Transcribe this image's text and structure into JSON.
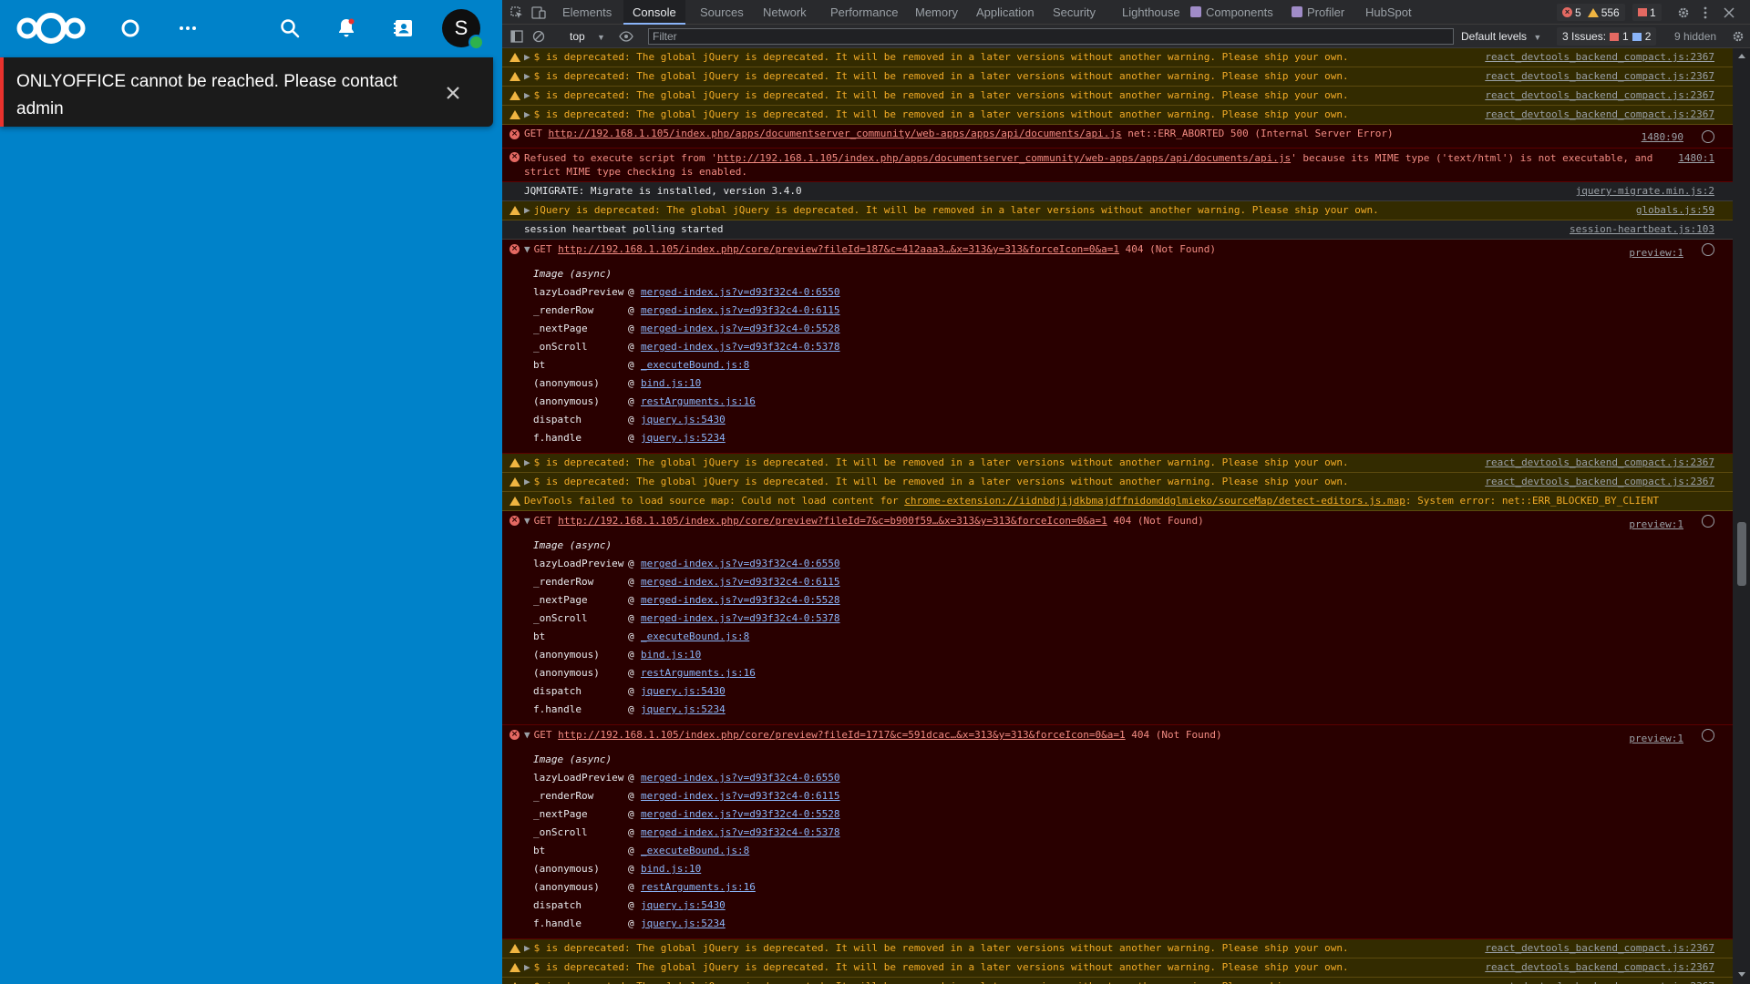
{
  "nextcloud": {
    "header_icons": [
      "nextcloud-logo",
      "dashboard-icon",
      "more-apps-icon",
      "search-icon",
      "notifications-icon",
      "contacts-icon"
    ],
    "avatar_initial": "S",
    "colors": {
      "background": "#0082c9",
      "toast_bg": "#1b1b1b",
      "toast_accent": "#e9322d",
      "status_online": "#2eb24d"
    }
  },
  "toast": {
    "message": "ONLYOFFICE cannot be reached. Please contact admin",
    "close_icon": "close-icon"
  },
  "devtools": {
    "tabs": [
      "Elements",
      "Console",
      "Sources",
      "Network",
      "Performance",
      "Memory",
      "Application",
      "Security",
      "Lighthouse",
      "Components",
      "Profiler",
      "HubSpot"
    ],
    "active_tab": "Console",
    "counts": {
      "errors": "5",
      "warnings": "556",
      "issues": "1"
    },
    "toolbar": {
      "context": "top",
      "filter_placeholder": "Filter",
      "levels": "Default levels",
      "issues_label": "3 Issues:",
      "issues_errors": "1",
      "issues_info": "2",
      "hidden": "9 hidden"
    },
    "colors": {
      "warn_bg": "#332b00",
      "warn_text": "#f2ab26",
      "error_bg": "#290000",
      "error_text": "#f28b82",
      "link": "#8ab4f8"
    }
  },
  "console": {
    "jquery_warning": "$ is deprecated: The global jQuery is deprecated. It will be removed in a later versions without another warning. Please ship your own.",
    "react_source": "react_devtools_backend_compact.js:2367",
    "get_api": {
      "method": "GET",
      "url": "http://192.168.1.105/index.php/apps/documentserver_community/web-apps/apps/api/documents/api.js",
      "status": "net::ERR_ABORTED 500 (Internal Server Error)",
      "source": "1480:90"
    },
    "mime_error": {
      "prefix": "Refused to execute script from '",
      "url": "http://192.168.1.105/index.php/apps/documentserver_community/web-apps/apps/api/documents/api.js",
      "suffix": "' because its MIME type ('text/html') is not executable, and",
      "line2": "strict MIME type checking is enabled.",
      "source": "1480:1"
    },
    "jqmigrate": {
      "text": "JQMIGRATE: Migrate is installed, version 3.4.0",
      "source": "jquery-migrate.min.js:2"
    },
    "jquery_global": {
      "text": "jQuery is deprecated: The global jQuery is deprecated. It will be removed in a later versions without another warning. Please ship your own.",
      "source": "globals.js:59"
    },
    "heartbeat": {
      "text": "session heartbeat polling started",
      "source": "session-heartbeat.js:103"
    },
    "preview_errors": [
      {
        "url": "http://192.168.1.105/index.php/core/preview?fileId=187&c=412aaa3…&x=313&y=313&forceIcon=0&a=1",
        "status": "404 (Not Found)",
        "source": "preview:1"
      },
      {
        "url": "http://192.168.1.105/index.php/core/preview?fileId=7&c=b900f59…&x=313&y=313&forceIcon=0&a=1",
        "status": "404 (Not Found)",
        "source": "preview:1"
      },
      {
        "url": "http://192.168.1.105/index.php/core/preview?fileId=1717&c=591dcac…&x=313&y=313&forceIcon=0&a=1",
        "status": "404 (Not Found)",
        "source": "preview:1"
      }
    ],
    "stack_label": "Image (async)",
    "stack_trace": [
      {
        "fn": "lazyLoadPreview",
        "loc": "merged-index.js?v=d93f32c4-0:6550"
      },
      {
        "fn": "_renderRow",
        "loc": "merged-index.js?v=d93f32c4-0:6115"
      },
      {
        "fn": "_nextPage",
        "loc": "merged-index.js?v=d93f32c4-0:5528"
      },
      {
        "fn": "_onScroll",
        "loc": "merged-index.js?v=d93f32c4-0:5378"
      },
      {
        "fn": "bt",
        "loc": "_executeBound.js:8"
      },
      {
        "fn": "(anonymous)",
        "loc": "bind.js:10"
      },
      {
        "fn": "(anonymous)",
        "loc": "restArguments.js:16"
      },
      {
        "fn": "dispatch",
        "loc": "jquery.js:5430"
      },
      {
        "fn": "f.handle",
        "loc": "jquery.js:5234"
      }
    ],
    "sourcemap_warning": {
      "prefix": "DevTools failed to load source map: Could not load content for ",
      "url": "chrome-extension://iidnbdjijdkbmajdffnidomddglmieko/sourceMap/detect-editors.js.map",
      "suffix": ": System error: net::ERR_BLOCKED_BY_CLIENT"
    }
  }
}
